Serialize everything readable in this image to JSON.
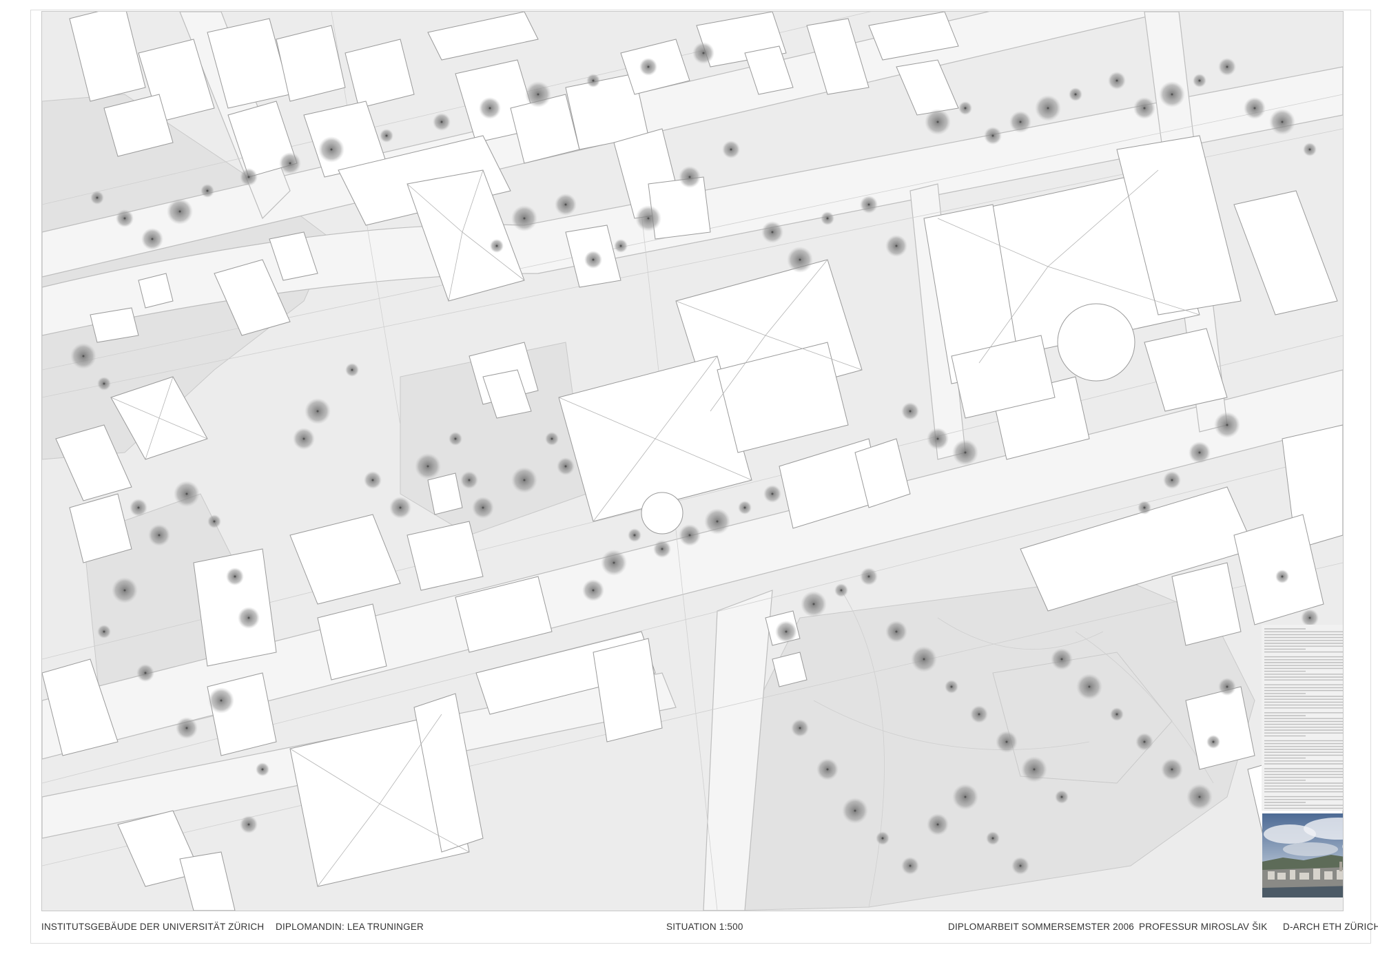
{
  "footer": {
    "project_title": "INSTITUTSGEBÄUDE DER UNIVERSITÄT  ZÜRICH",
    "author": "DIPLOMANDIN: LEA TRUNINGER",
    "plan_label": "SITUATION  1:500",
    "thesis": "DIPLOMARBEIT  SOMMERSEMSTER 2006",
    "professor": "PROFESSUR MIROSLAV ŠIK",
    "school": "D-ARCH ETH ZÜRICH"
  },
  "map": {
    "type": "site plan",
    "scale": "1:500",
    "colors": {
      "ground": "#ececec",
      "building": "#ffffff",
      "building_outline": "#9a9a9a",
      "street": "#f4f4f4",
      "green": "#e0e0e0",
      "tree": "#8c8c8c"
    }
  },
  "panel": {
    "photo_alt": "panorama photo of Zürich"
  }
}
